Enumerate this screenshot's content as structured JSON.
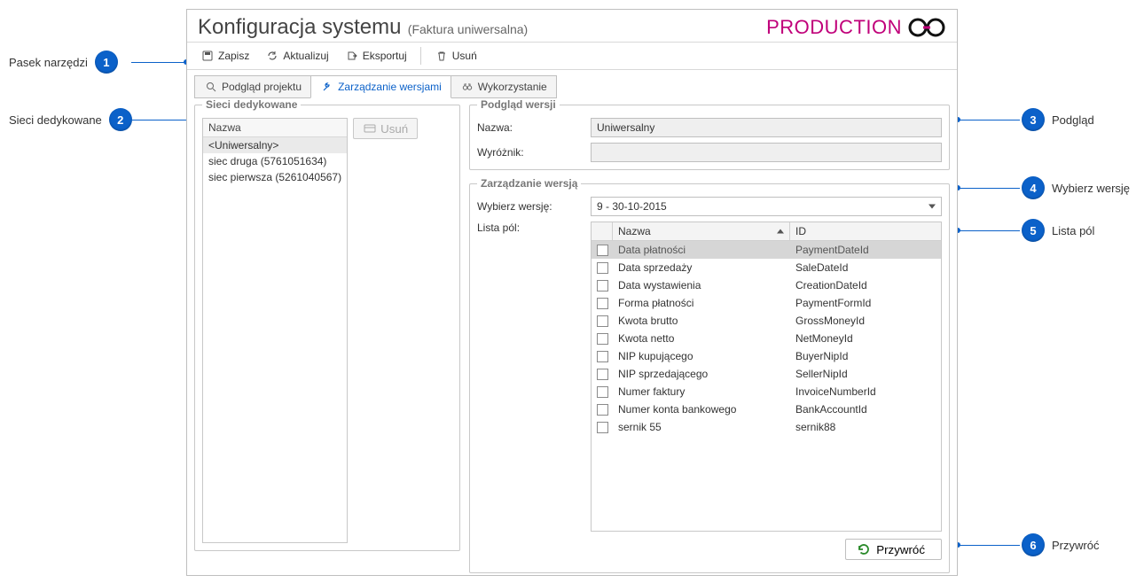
{
  "title": {
    "main": "Konfiguracja systemu",
    "sub": "(Faktura uniwersalna)"
  },
  "brand": {
    "text": "PRODUCTION"
  },
  "toolbar": {
    "save": "Zapisz",
    "update": "Aktualizuj",
    "export": "Eksportuj",
    "delete": "Usuń"
  },
  "tabs": {
    "preview": "Podgląd projektu",
    "versions": "Zarządzanie wersjami",
    "usage": "Wykorzystanie"
  },
  "networks": {
    "legend": "Sieci dedykowane",
    "header": "Nazwa",
    "delete": "Usuń",
    "items": [
      "<Uniwersalny>",
      "siec druga (5761051634)",
      "siec pierwsza (5261040567)"
    ]
  },
  "preview": {
    "legend": "Podgląd wersji",
    "name_label": "Nazwa:",
    "name_value": "Uniwersalny",
    "disc_label": "Wyróżnik:",
    "disc_value": ""
  },
  "version": {
    "legend": "Zarządzanie wersją",
    "select_label": "Wybierz wersję:",
    "select_value": "9 - 30-10-2015",
    "fields_label": "Lista pól:",
    "col_name": "Nazwa",
    "col_id": "ID",
    "rows": [
      {
        "name": "Data płatności",
        "id": "PaymentDateId"
      },
      {
        "name": "Data sprzedaży",
        "id": "SaleDateId"
      },
      {
        "name": "Data wystawienia",
        "id": "CreationDateId"
      },
      {
        "name": "Forma płatności",
        "id": "PaymentFormId"
      },
      {
        "name": "Kwota brutto",
        "id": "GrossMoneyId"
      },
      {
        "name": "Kwota netto",
        "id": "NetMoneyId"
      },
      {
        "name": "NIP kupującego",
        "id": "BuyerNipId"
      },
      {
        "name": "NIP sprzedającego",
        "id": "SellerNipId"
      },
      {
        "name": "Numer faktury",
        "id": "InvoiceNumberId"
      },
      {
        "name": "Numer konta bankowego",
        "id": "BankAccountId"
      },
      {
        "name": "sernik 55",
        "id": "sernik88"
      }
    ],
    "restore": "Przywróć"
  },
  "callouts": {
    "c1": "Pasek narzędzi",
    "c2": "Sieci dedykowane",
    "c3": "Podgląd",
    "c4": "Wybierz wersję",
    "c5": "Lista pól",
    "c6": "Przywróć"
  }
}
